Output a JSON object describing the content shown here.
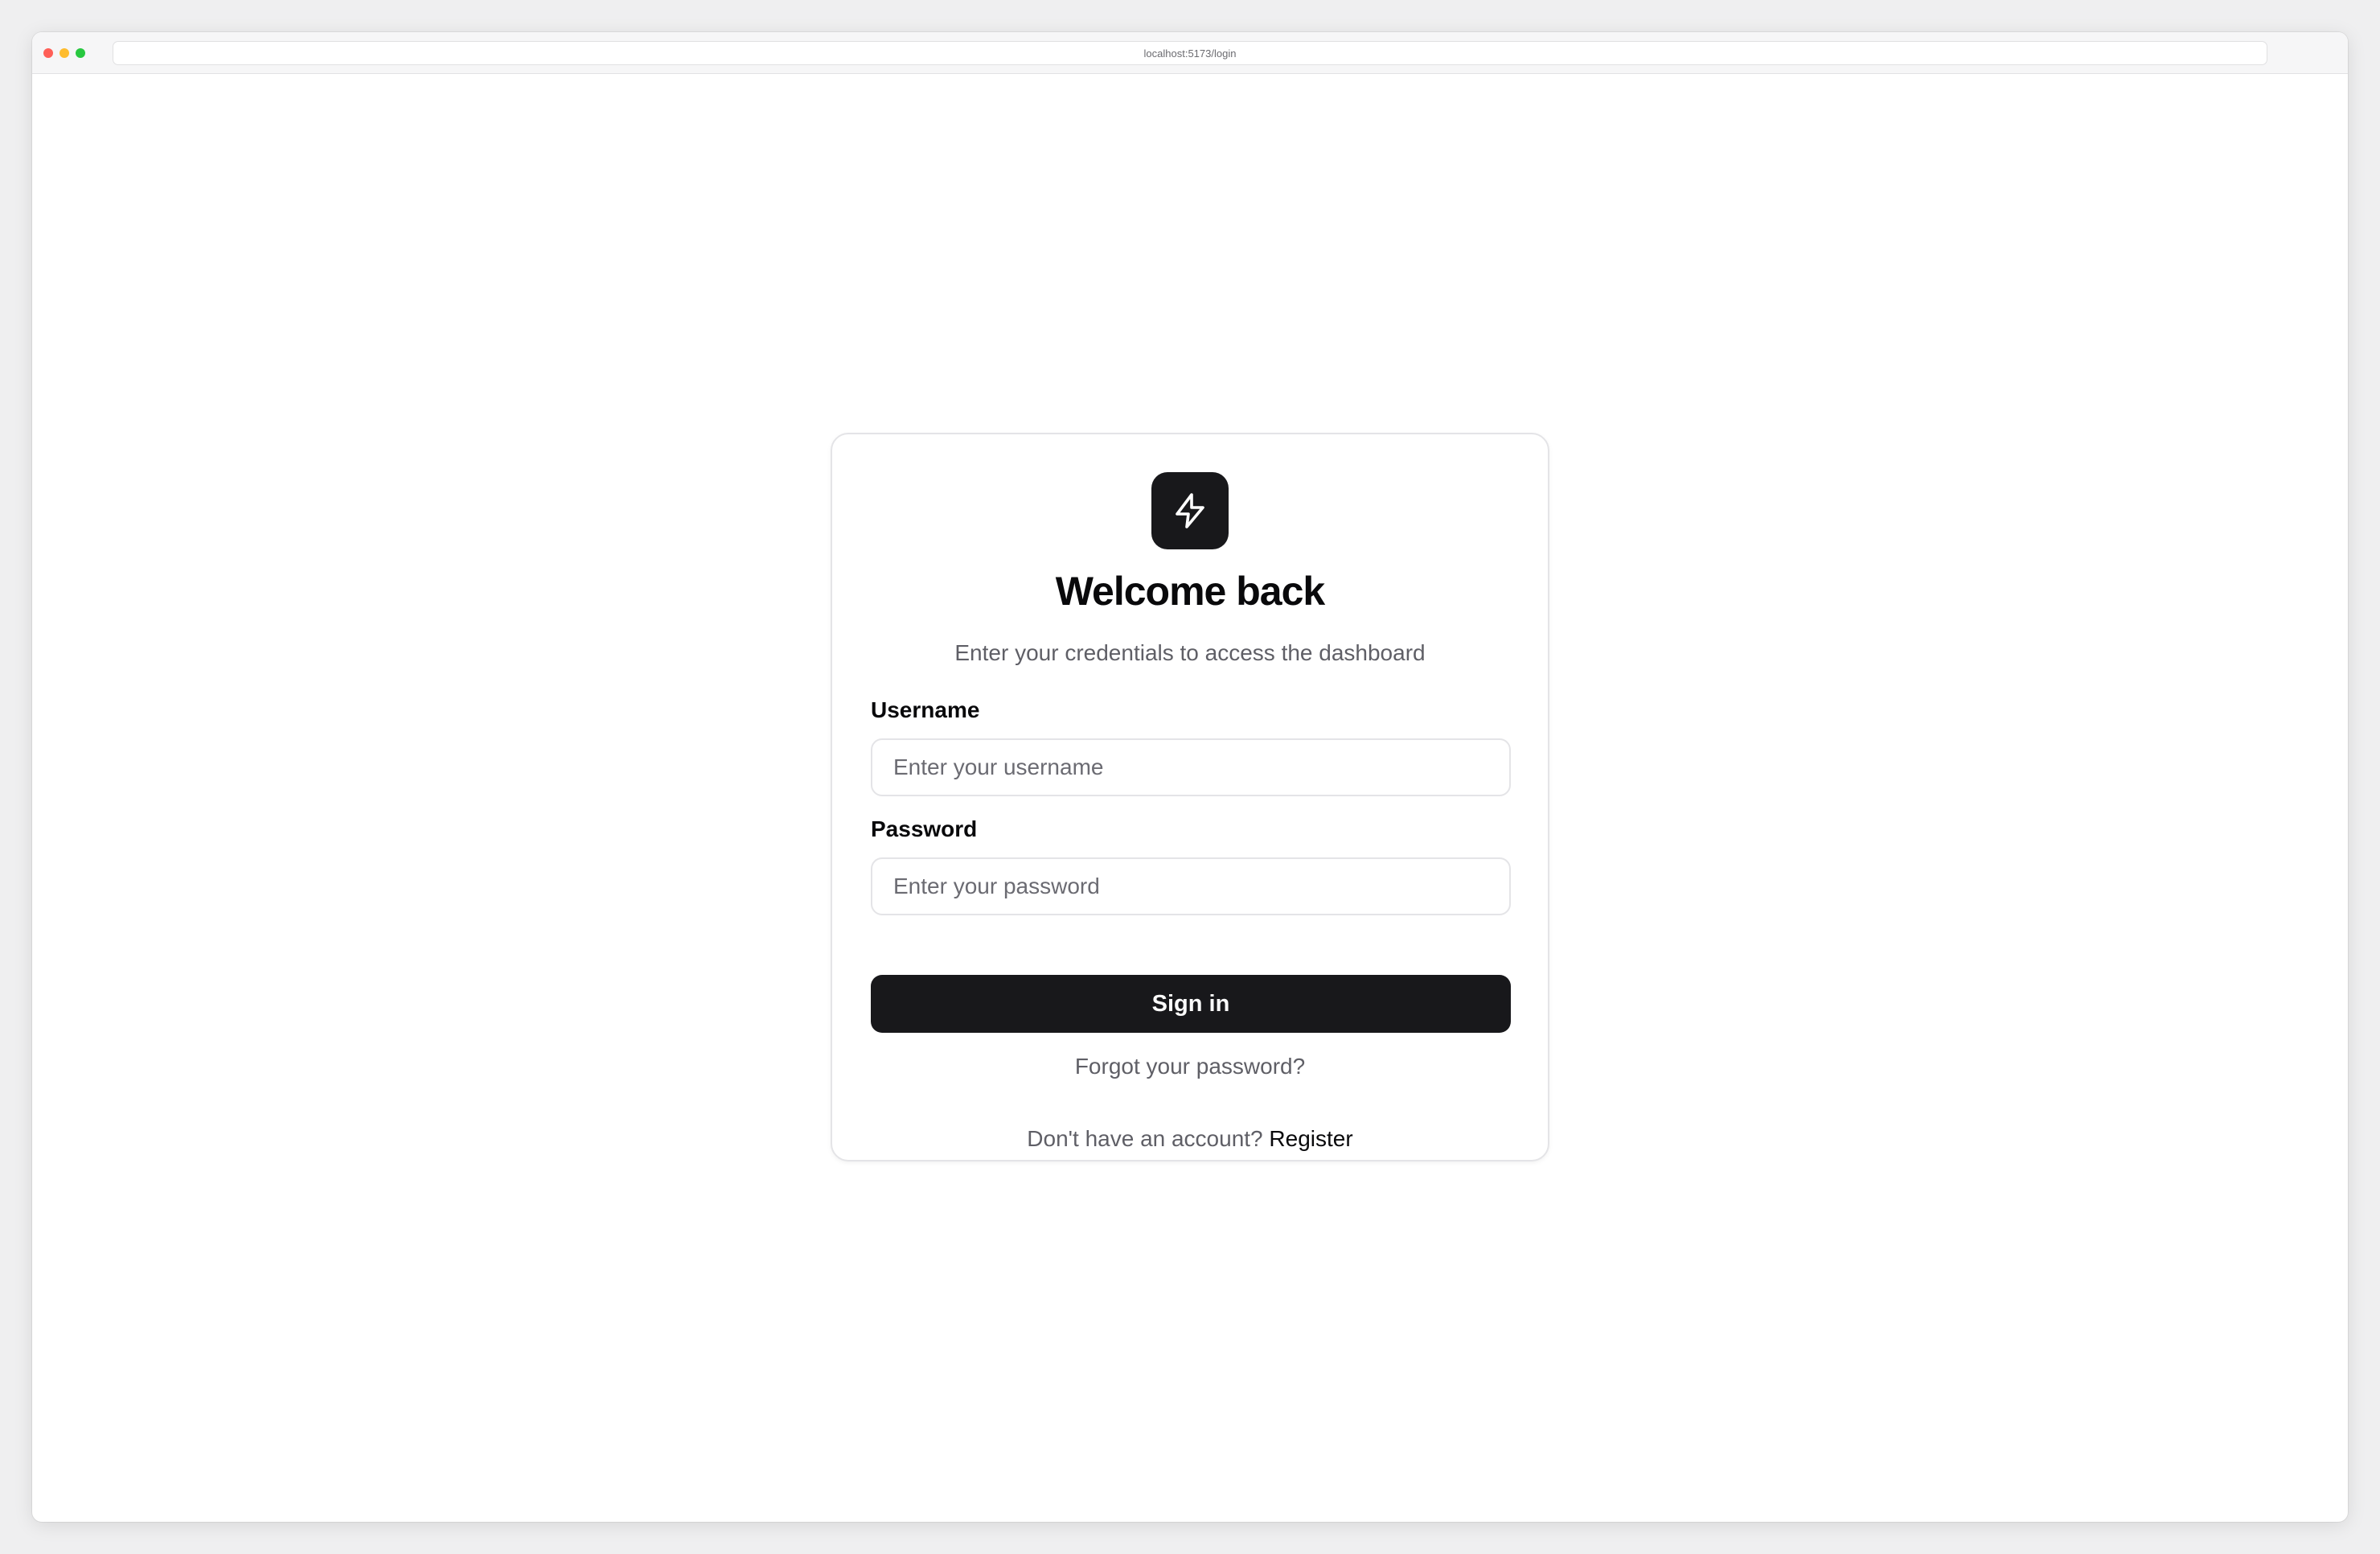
{
  "browser": {
    "url": "localhost:5173/login"
  },
  "login": {
    "title": "Welcome back",
    "subtitle": "Enter your credentials to access the dashboard",
    "username_label": "Username",
    "username_placeholder": "Enter your username",
    "username_value": "",
    "password_label": "Password",
    "password_placeholder": "Enter your password",
    "password_value": "",
    "signin_label": "Sign in",
    "forgot_label": "Forgot your password?",
    "no_account_text": "Don't have an account?",
    "register_label": "Register"
  },
  "icons": {
    "logo": "lightning-bolt-icon"
  },
  "colors": {
    "primary": "#18181b",
    "muted_text": "#5f5f66",
    "border": "#e4e4e7"
  }
}
